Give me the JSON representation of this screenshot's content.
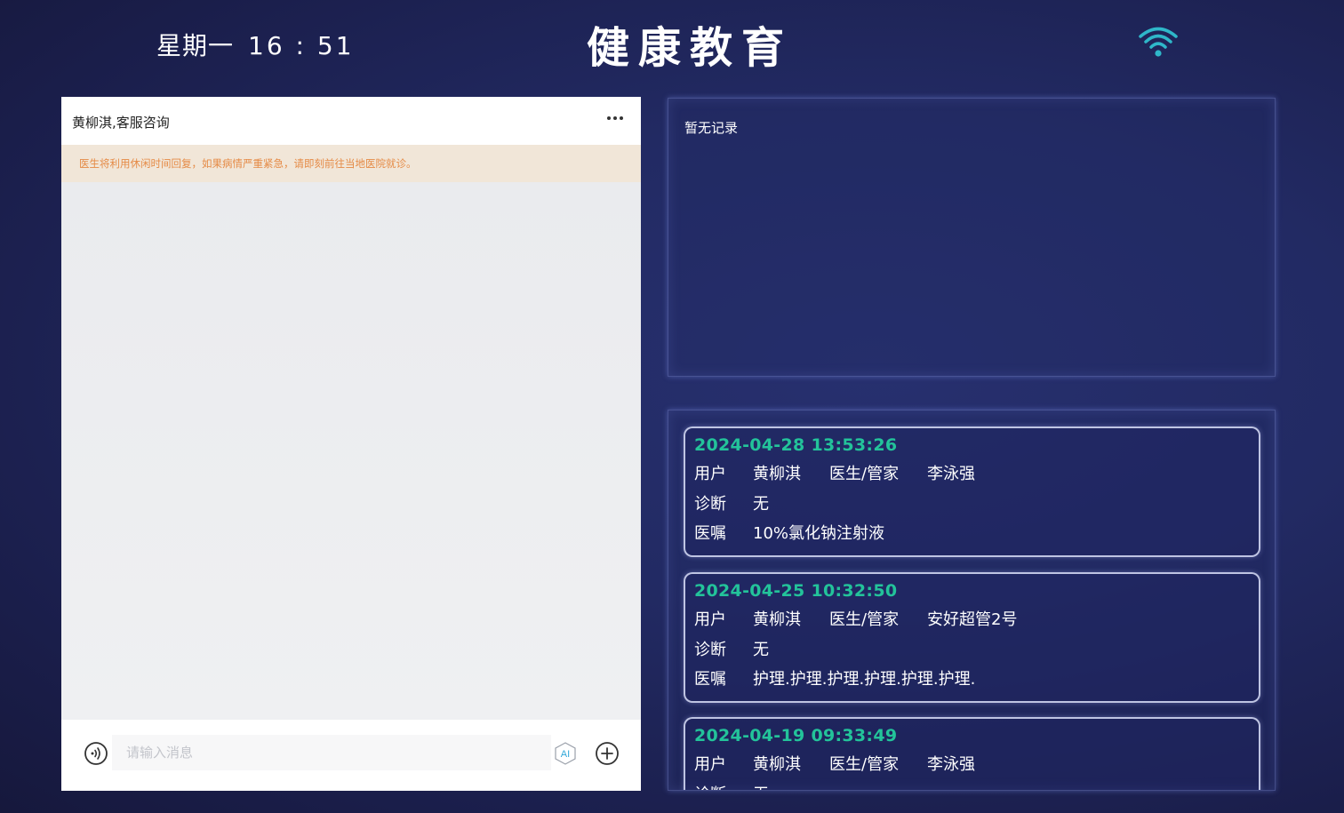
{
  "header": {
    "weekday": "星期一",
    "time": "16 : 51",
    "title": "健康教育",
    "wifi_icon": "wifi-icon",
    "accent_color": "#2fb7c9"
  },
  "chat": {
    "title": "黄柳淇,客服咨询",
    "notice": "医生将利用休闲时间回复，如果病情严重紧急，请即刻前往当地医院就诊。",
    "input_placeholder": "请输入消息",
    "ai_label": "AI"
  },
  "records": {
    "empty_text": "暂无记录"
  },
  "orders": {
    "labels": {
      "user": "用户",
      "doctor": "医生/管家",
      "diagnosis": "诊断",
      "advice": "医嘱"
    },
    "items": [
      {
        "time": "2024-04-28 13:53:26",
        "user": "黄柳淇",
        "doctor": "李泳强",
        "diagnosis": "无",
        "advice": "10%氯化钠注射液"
      },
      {
        "time": "2024-04-25 10:32:50",
        "user": "黄柳淇",
        "doctor": "安好超管2号",
        "diagnosis": "无",
        "advice": "护理.护理.护理.护理.护理.护理."
      },
      {
        "time": "2024-04-19 09:33:49",
        "user": "黄柳淇",
        "doctor": "李泳强",
        "diagnosis": "无",
        "advice": ""
      }
    ],
    "time_color": "#23c39a"
  }
}
